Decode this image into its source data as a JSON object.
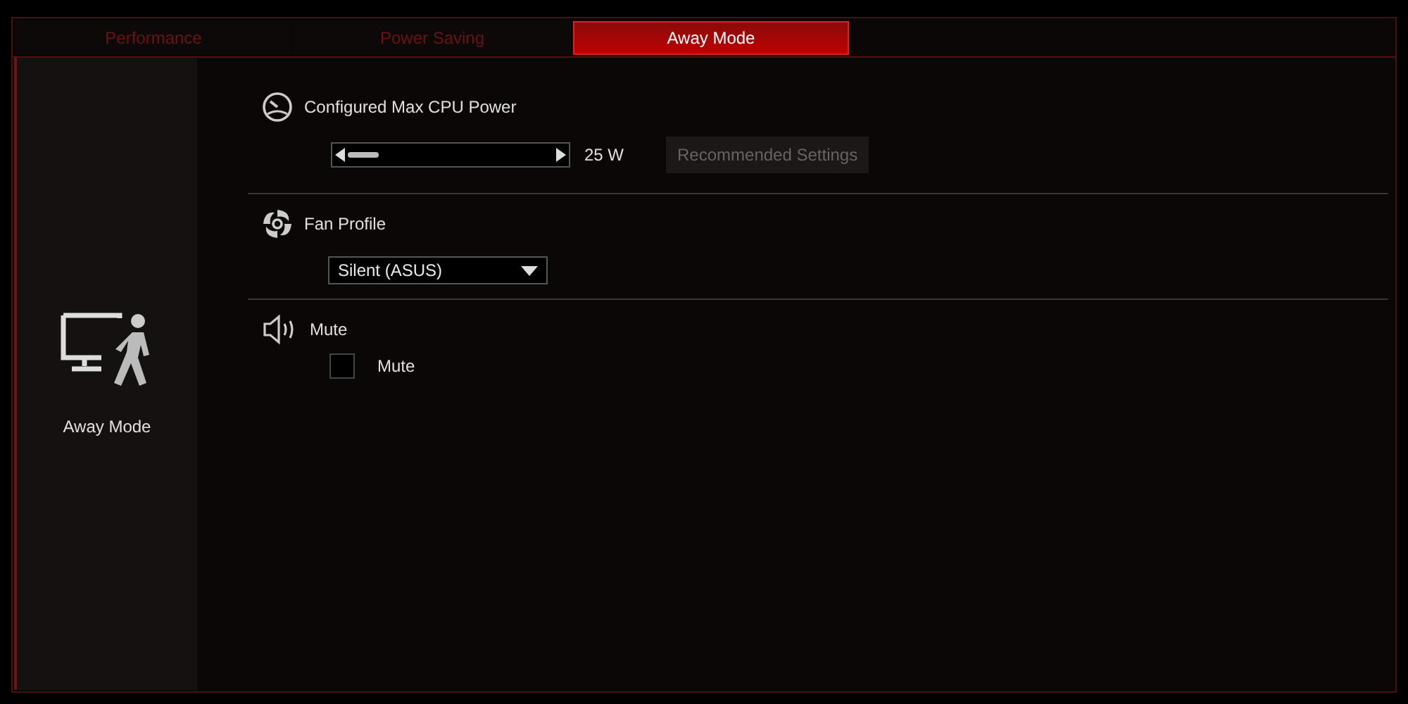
{
  "tabs": [
    {
      "label": "Performance",
      "selected": false
    },
    {
      "label": "Power Saving",
      "selected": false
    },
    {
      "label": "Away Mode",
      "selected": true
    }
  ],
  "sidebar": {
    "label": "Away Mode"
  },
  "sections": [
    {
      "kind": "slider",
      "title": "Configured Max CPU Power",
      "level": 0.15,
      "reading": "25 W",
      "button": {
        "label": "Recommended Settings",
        "disabled": true
      }
    },
    {
      "kind": "dropdown",
      "title": "Fan Profile",
      "value": "Silent (ASUS)"
    },
    {
      "kind": "checkbox",
      "title": "Mute",
      "label": "Mute",
      "checked": false
    }
  ]
}
